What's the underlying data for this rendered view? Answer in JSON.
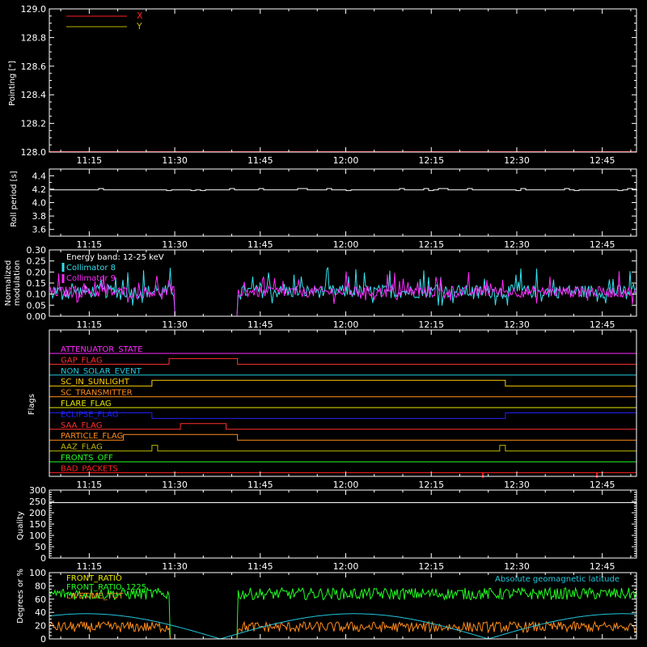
{
  "colors": {
    "background": "#000000",
    "axis": "#ffffff",
    "x_line": "#ff2020",
    "y_line": "#b8b800",
    "white": "#ffffff",
    "cyan": "#33e0ee",
    "magenta": "#ff2aff",
    "green": "#22ff22",
    "orange": "#ff8c1a",
    "lightcyan": "#22c8dd"
  },
  "time_axis": {
    "start": "11:08",
    "end": "12:51",
    "tick_labels": [
      "11:15",
      "11:30",
      "11:45",
      "12:00",
      "12:15",
      "12:30",
      "12:45"
    ]
  },
  "chart_data": [
    {
      "id": "pointing",
      "type": "line",
      "ylabel": "Pointing [\"]",
      "ylim": [
        128.0,
        129.0
      ],
      "yticks": [
        "128.0",
        "128.2",
        "128.4",
        "128.6",
        "128.8",
        "129.0"
      ],
      "legend_position": "top-left",
      "series": [
        {
          "name": "X",
          "color": "#ff2020",
          "value": 128.0
        },
        {
          "name": "Y",
          "color": "#b8b800",
          "value": 128.0
        }
      ]
    },
    {
      "id": "roll-period",
      "type": "line",
      "ylabel": "Roll period [s]",
      "ylim": [
        3.5,
        4.5
      ],
      "yticks": [
        "3.6",
        "3.8",
        "4.0",
        "4.2",
        "4.4"
      ],
      "series": [
        {
          "color": "#ffffff",
          "mean": 4.19
        }
      ]
    },
    {
      "id": "modulation",
      "type": "line",
      "ylabel_lines": [
        "Normalized",
        "modulation"
      ],
      "ylim": [
        0.0,
        0.3
      ],
      "yticks": [
        "0.00",
        "0.05",
        "0.10",
        "0.15",
        "0.20",
        "0.25",
        "0.30"
      ],
      "annotation": "Energy band: 12-25 keV",
      "gap": [
        "11:30",
        "11:41"
      ],
      "series": [
        {
          "name": "Collimator 8",
          "color": "#33e0ee"
        },
        {
          "name": "Collimator 9",
          "color": "#ff2aff"
        }
      ]
    },
    {
      "id": "flags",
      "type": "line",
      "ylabel": "Flags",
      "series": [
        {
          "name": "ATTENUATOR_STATE",
          "color": "#ff2aff",
          "high": []
        },
        {
          "name": "GAP_FLAG",
          "color": "#ff3030",
          "high": [
            [
              "11:29",
              "11:41"
            ]
          ]
        },
        {
          "name": "NON_SOLAR_EVENT",
          "color": "#22c8dd",
          "high": []
        },
        {
          "name": "SC_IN_SUNLIGHT",
          "color": "#ffd000",
          "high": [
            [
              "11:26",
              "12:28"
            ]
          ]
        },
        {
          "name": "SC_TRANSMITTER",
          "color": "#ff8c1a",
          "high": []
        },
        {
          "name": "FLARE_FLAG",
          "color": "#e8e800",
          "high": []
        },
        {
          "name": "ECLIPSE_FLAG",
          "color": "#2222ff",
          "high": [
            [
              "11:08",
              "11:26"
            ],
            [
              "12:28",
              "12:51"
            ]
          ]
        },
        {
          "name": "SAA_FLAG",
          "color": "#ff3030",
          "high": [
            [
              "11:31",
              "11:39"
            ]
          ]
        },
        {
          "name": "PARTICLE_FLAG",
          "color": "#ff8c1a",
          "high": [
            [
              "11:21",
              "11:41"
            ]
          ]
        },
        {
          "name": "AAZ_FLAG",
          "color": "#b8b800",
          "high": [
            [
              "11:26",
              "11:27"
            ],
            [
              "12:27",
              "12:28"
            ]
          ]
        },
        {
          "name": "FRONTS_OFF",
          "color": "#22ff22",
          "high": []
        },
        {
          "name": "BAD_PACKETS",
          "color": "#ff2020",
          "high": [
            [
              "12:24",
              "12:24"
            ],
            [
              "12:44",
              "12:44"
            ]
          ]
        }
      ]
    },
    {
      "id": "quality",
      "type": "line",
      "ylabel": "Quality",
      "ylim": [
        0,
        300
      ],
      "yticks": [
        "0",
        "50",
        "100",
        "150",
        "200",
        "250",
        "300"
      ],
      "series": []
    },
    {
      "id": "geomag",
      "type": "line",
      "ylabel": "Degrees or %",
      "ylim": [
        0,
        100
      ],
      "yticks": [
        "0",
        "20",
        "40",
        "60",
        "80",
        "100"
      ],
      "gap": [
        "11:29",
        "11:41"
      ],
      "series": [
        {
          "name": "FRONT_RATIO",
          "color": "#e8e800"
        },
        {
          "name": "FRONT_RATIO_1225",
          "color": "#22ff22"
        },
        {
          "name": "LIVETIME_TOT",
          "color": "#ff8c1a"
        },
        {
          "name": "Absolute geomagnetic latitude",
          "color": "#22c8dd"
        }
      ]
    }
  ]
}
